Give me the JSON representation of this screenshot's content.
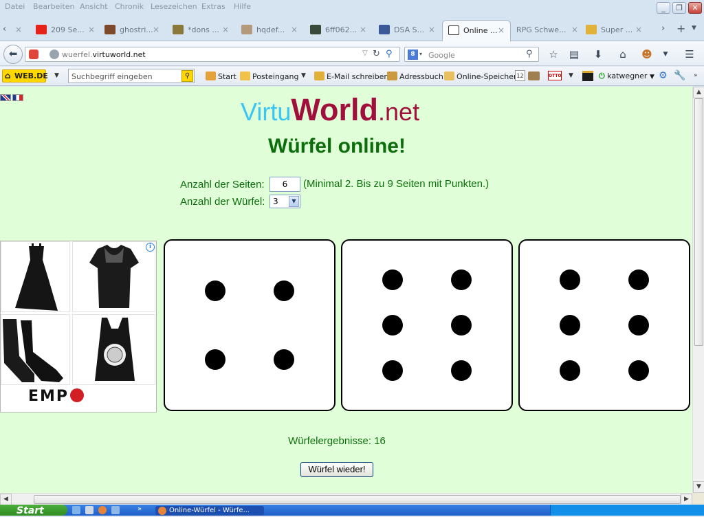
{
  "browser": {
    "menu": [
      "Datei",
      "Bearbeiten",
      "Ansicht",
      "Chronik",
      "Lesezeichen",
      "Extras",
      "Hilfe"
    ],
    "tabs": [
      {
        "label": "209 Se...",
        "icon": "youtube-icon",
        "color": "#e62117"
      },
      {
        "label": "ghostri...",
        "icon": "image-icon",
        "color": "#7a4a2a"
      },
      {
        "label": "*dons ...",
        "icon": "image-icon",
        "color": "#8a7a3a"
      },
      {
        "label": "hqdef...",
        "icon": "image-icon",
        "color": "#b39a7a"
      },
      {
        "label": "6ff062...",
        "icon": "image-icon",
        "color": "#3a4a3a"
      },
      {
        "label": "DSA S...",
        "icon": "facebook-icon",
        "color": "#3b5998"
      },
      {
        "label": "Online ...",
        "icon": "dice-icon",
        "color": "#333333"
      },
      {
        "label": "RPG Schwe...",
        "icon": "page-icon",
        "color": "#c9d3df"
      },
      {
        "label": "Super ...",
        "icon": "crown-icon",
        "color": "#e0b23a"
      }
    ],
    "url_prefix": "wuerfel.",
    "url_domain": "virtuworld.net",
    "search_placeholder": "Google",
    "bookmarks": {
      "brand": "WEB.DE",
      "search_placeholder": "Suchbegriff eingeben",
      "items": [
        "Start",
        "Posteingang",
        "E-Mail schreiben",
        "Adressbuch",
        "Online-Speicher"
      ],
      "calendar_day": "12",
      "otto": "OTTO",
      "user": "katwegner"
    }
  },
  "page": {
    "logo_virtu": "Virtu",
    "logo_world": "World",
    "logo_net": ".net",
    "title": "Würfel online!",
    "sides_label": "Anzahl der Seiten:",
    "sides_value": "6",
    "sides_hint": "(Minimal 2. Bis zu 9 Seiten mit Punkten.)",
    "count_label": "Anzahl der Würfel:",
    "count_value": "3",
    "ad_brand": "EMP",
    "ad_info": "i",
    "dice": [
      4,
      6,
      6
    ],
    "result": "Würfelergebnisse: 16",
    "roll_button": "Würfel wieder!"
  },
  "taskbar": {
    "start": "Start",
    "item": "Online-Würfel - Würfe..."
  }
}
